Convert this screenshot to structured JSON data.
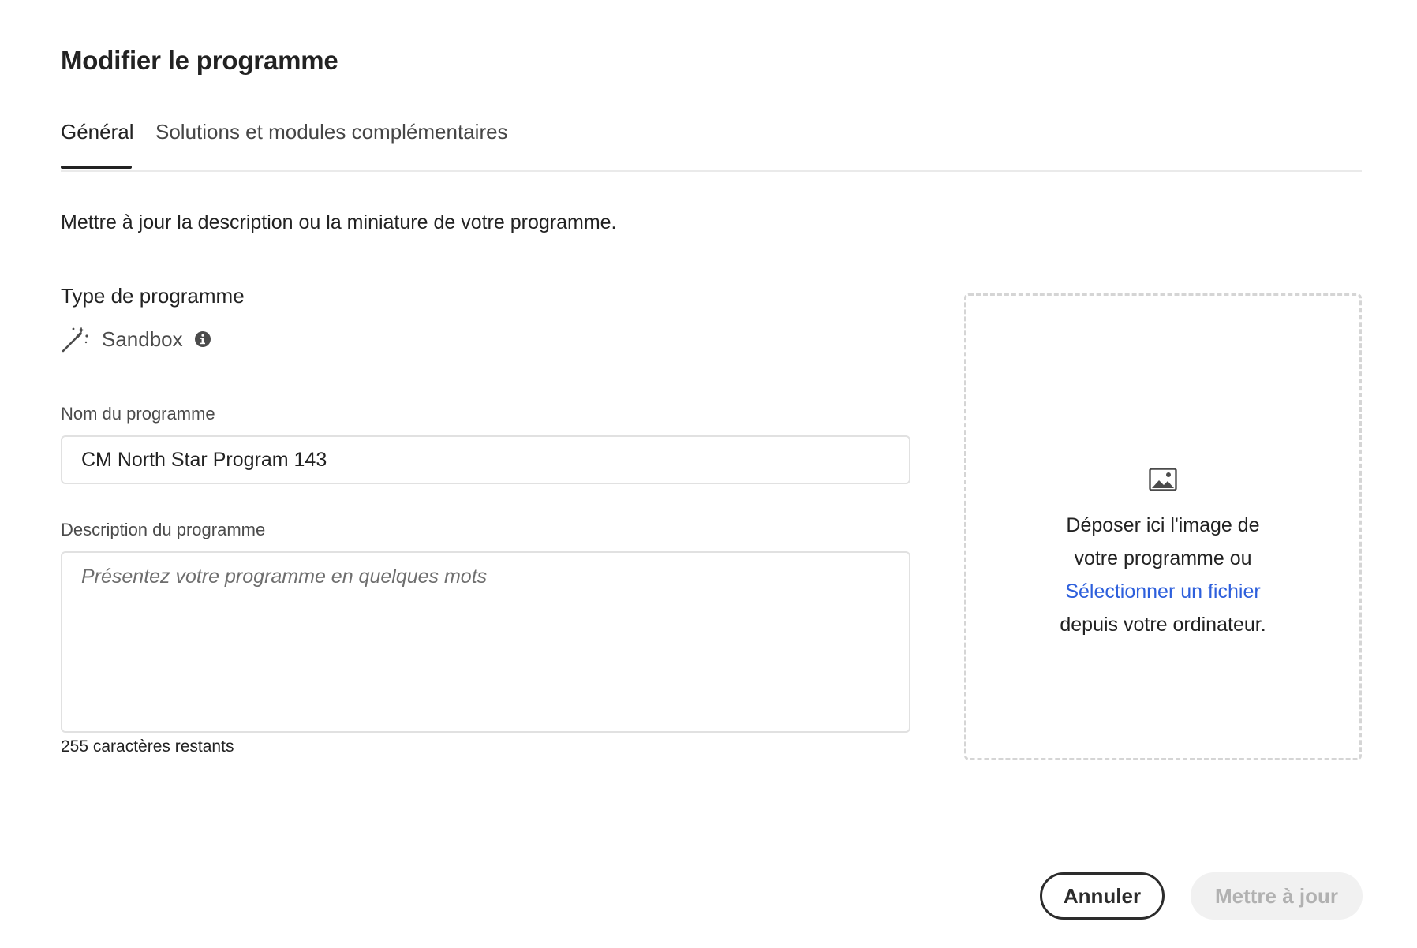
{
  "dialog": {
    "title": "Modifier le programme"
  },
  "tabs": [
    {
      "label": "Général",
      "selected": true
    },
    {
      "label": "Solutions et modules complémentaires",
      "selected": false
    }
  ],
  "intro": "Mettre à jour la description ou la miniature de votre programme.",
  "program_type": {
    "label": "Type de programme",
    "value": "Sandbox",
    "icon": "magic-wand-icon",
    "info_icon": "info-icon"
  },
  "name_field": {
    "label": "Nom du programme",
    "value": "CM North Star Program 143"
  },
  "description_field": {
    "label": "Description du programme",
    "placeholder": "Présentez votre programme en quelques mots",
    "value": "",
    "remaining": "255 caractères restants"
  },
  "dropzone": {
    "icon": "image-icon",
    "line1": "Déposer ici l'image de",
    "line2": "votre programme ou",
    "link": "Sélectionner un fichier",
    "line3": "depuis votre ordinateur."
  },
  "buttons": {
    "cancel": "Annuler",
    "update": "Mettre à jour",
    "update_disabled": true
  },
  "colors": {
    "link": "#2d5fdc",
    "text": "#222222",
    "border": "#e1e1e1",
    "disabled_bg": "#f1f1f1",
    "disabled_text": "#b1b1b1"
  }
}
